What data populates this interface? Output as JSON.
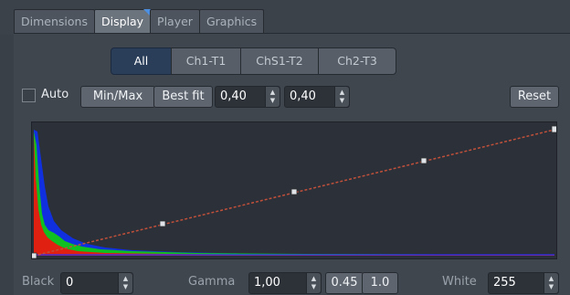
{
  "tabs": [
    "Dimensions",
    "Display",
    "Player",
    "Graphics"
  ],
  "channels": [
    "All",
    "Ch1-T1",
    "ChS1-T2",
    "Ch2-T3"
  ],
  "toolbar": {
    "auto_label": "Auto",
    "minmax_label": "Min/Max",
    "bestfit_label": "Best fit",
    "bestfit_low": "0,40",
    "bestfit_high": "0,40",
    "reset_label": "Reset"
  },
  "bottom": {
    "black_label": "Black",
    "black_value": "0",
    "gamma_label": "Gamma",
    "gamma_value": "1,00",
    "gamma_preset_1": "0.45",
    "gamma_preset_2": "1.0",
    "white_label": "White",
    "white_value": "255"
  },
  "colors": {
    "accent": "#4c8fe0",
    "curve": "#c0503a",
    "histogram_blue": "#1030e0",
    "histogram_green": "#10c020",
    "histogram_red": "#e02010"
  }
}
